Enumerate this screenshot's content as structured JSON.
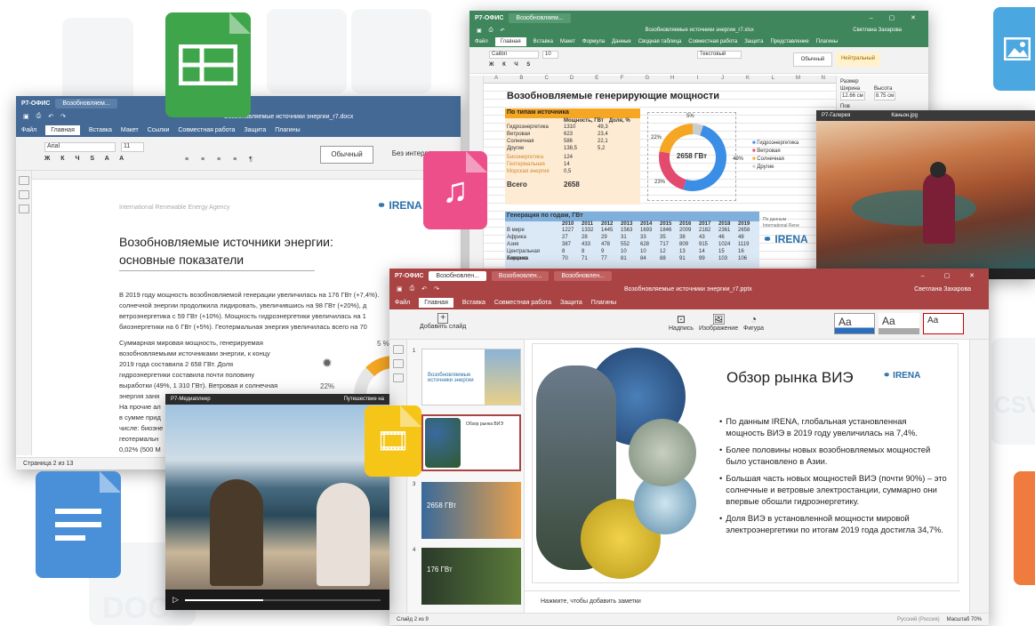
{
  "background": {
    "ghost_labels": [
      "DOC",
      "CSV"
    ]
  },
  "doc": {
    "brand": "Р7-ОФИС",
    "tab": "Возобновляем...",
    "title": "Возобновляемые источники энергии_r7.docx",
    "menus": [
      "Файл",
      "Главная",
      "Вставка",
      "Макет",
      "Ссылки",
      "Совместная работа",
      "Защита",
      "Плагины"
    ],
    "active_menu": "Главная",
    "font": "Arial",
    "size": "11",
    "styles": [
      "Обычный",
      "Без интервала"
    ],
    "header_left": "International Renewable Energy Agency",
    "irena": "IRENA",
    "heading_line1": "Возобновляемые источники энергии:",
    "heading_line2": "основные показатели",
    "para1": [
      "В 2019 году мощность возобновляемой генерации увеличилась на 176 ГВт (+7,4%).",
      "солнечной энергии продолжила лидировать, увеличившись на 98 ГВт (+20%), д",
      "ветроэнергетика с 59 ГВт (+10%). Мощность гидроэнергетики увеличилась на 1",
      "биоэнергетики на 6 ГВт (+5%). Геотермальная энергия увеличилась всего на 70"
    ],
    "para2": [
      "Суммарная мировая мощность, генерируемая",
      "возобновляемыми источниками энергии, к концу",
      "2019 года составила 2 658 ГВт. Доля",
      "гидроэнергетики составила почти половину",
      "выработки (49%, 1 310 ГВт). Ветровая и солнечная",
      "энергия заня",
      "На прочие ал",
      "в сумме прид",
      "числе: биоэне",
      "геотермальн",
      "0,02% (500 М"
    ],
    "donut_pct_top": "5 %",
    "donut_pct_left": "22%",
    "status": "Страница 2 из 13"
  },
  "sheet": {
    "brand": "Р7-ОФИС",
    "tab": "Возобновляем...",
    "title": "Возобновляемые источники энергии_r7.xlsx",
    "user": "Светлана Захарова",
    "menus": [
      "Файл",
      "Главная",
      "Вставка",
      "Макет",
      "Формула",
      "Данные",
      "Сводная таблица",
      "Совместная работа",
      "Защита",
      "Представление",
      "Плагины"
    ],
    "active_menu": "Главная",
    "font": "Calibri",
    "size": "10",
    "number_format": "Текстовый",
    "style_normal": "Обычный",
    "style_neutral": "Нейтральный",
    "size_panel": {
      "label": "Размер",
      "width_label": "Ширина",
      "width": "12.66 см",
      "height_label": "Высота",
      "height": "8.75 см",
      "rotate": "Пов"
    },
    "columns": [
      "A",
      "B",
      "C",
      "D",
      "E",
      "F",
      "G",
      "H",
      "I",
      "J",
      "K",
      "L",
      "M",
      "N"
    ],
    "heading": "Возобновляемые генерирующие мощности",
    "by_source_title": "По типам источника",
    "by_source_header": [
      "Мощность, ГВт",
      "Доля, %"
    ],
    "by_source_rows": [
      [
        "Гидроэнергетика",
        "1310",
        "49,3"
      ],
      [
        "Ветровая",
        "623",
        "23,4"
      ],
      [
        "Солнечная",
        "586",
        "22,1"
      ],
      [
        "Другие",
        "138,5",
        "5,2"
      ]
    ],
    "others_rows": [
      [
        "Биоэнергетика",
        "124"
      ],
      [
        "Геотермальная",
        "14"
      ],
      [
        "Морская энергия",
        "0,5"
      ]
    ],
    "total_label": "Всего",
    "total": "2658",
    "chart": {
      "center": "2658 ГВт",
      "pct_top": "5%",
      "pct_left": "22%",
      "pct_right": "49%",
      "pct_bottom": "23%",
      "legend": [
        "Гидроэнергетика",
        "Ветровая",
        "Солнечная",
        "Другие"
      ]
    },
    "by_year_title": "Генерация по годам, ГВт",
    "years": [
      "2010",
      "2011",
      "2012",
      "2013",
      "2014",
      "2015",
      "2016",
      "2017",
      "2018",
      "2019"
    ],
    "year_rows": [
      [
        "В мире",
        "1227",
        "1332",
        "1445",
        "1563",
        "1693",
        "1846",
        "2009",
        "2182",
        "2361",
        "2658"
      ],
      [
        "Африка",
        "27",
        "28",
        "29",
        "31",
        "33",
        "35",
        "38",
        "43",
        "46",
        "48"
      ],
      [
        "Азия",
        "387",
        "433",
        "478",
        "552",
        "628",
        "717",
        "809",
        "915",
        "1024",
        "1119"
      ],
      [
        "Центральная Америка",
        "8",
        "8",
        "9",
        "10",
        "10",
        "12",
        "13",
        "14",
        "15",
        "16"
      ],
      [
        "Евразия",
        "70",
        "71",
        "77",
        "81",
        "84",
        "88",
        "91",
        "99",
        "103",
        "106"
      ]
    ],
    "source_note": [
      "По данным",
      "International Rene"
    ],
    "irena": "IRENA"
  },
  "photo": {
    "brand": "Р7-Галерея",
    "file": "Каньон.jpg"
  },
  "media": {
    "brand": "Р7-Медиаплеер",
    "title": "Путешествие на",
    "progress": 0.4
  },
  "pres": {
    "brand": "Р7-ОФИС",
    "tabs": [
      "Возобновлен...",
      "Возобновлен...",
      "Возобновлен..."
    ],
    "title": "Возобновляемые источники энергии_r7.pptx",
    "user": "Светлана Захарова",
    "menus": [
      "Файл",
      "Главная",
      "Вставка",
      "Совместная работа",
      "Защита",
      "Плагины"
    ],
    "active_menu": "Главная",
    "add_slide": "Добавить слайд",
    "tools": [
      "Надпись",
      "Изображение",
      "Фигура"
    ],
    "theme_samples": [
      "Aa",
      "Aa",
      "Aa"
    ],
    "thumbs": [
      {
        "num": "1",
        "title": "Возобновляемые источники энергии"
      },
      {
        "num": "2",
        "title": "Обзор рынка ВИЭ"
      },
      {
        "num": "3",
        "title": "2658 ГВт"
      },
      {
        "num": "4",
        "title": "176 ГВт"
      }
    ],
    "slide_title": "Обзор рынка ВИЭ",
    "irena": "IRENA",
    "bullets": [
      "По данным IRENA, глобальная установленная мощность ВИЭ в 2019 году увеличилась на 7,4%.",
      "Более половины новых возобновляемых мощностей было установлено в Азии.",
      "Большая часть новых мощностей ВИЭ (почти 90%) – это солнечные и ветровые электростанции, суммарно они впервые обошли гидроэнергетику.",
      "Доля ВИЭ в установленной мощности мировой электроэнергетики по итогам 2019 года достигла 34,7%."
    ],
    "notes": "Нажмите, чтобы добавить заметки",
    "status_left": "Слайд 2 из 9",
    "lang": "Русский (Россия)",
    "zoom": "Масштаб 70%"
  }
}
